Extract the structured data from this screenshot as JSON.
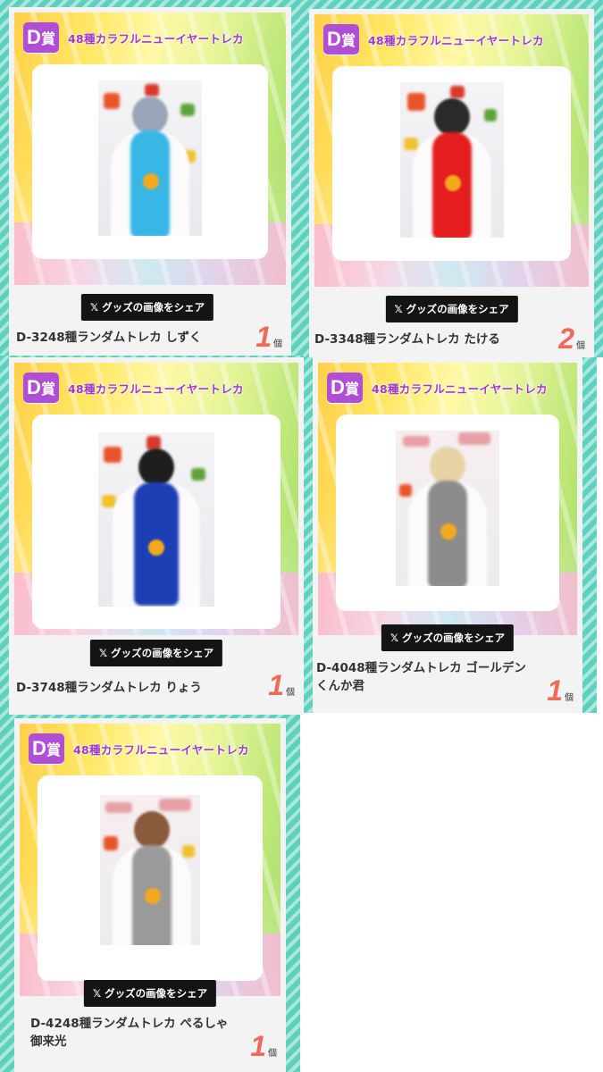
{
  "cards": [
    {
      "prize_letter": "D",
      "prize_suffix": "賞",
      "prize_title": "48種カラフルニューイヤートレカ",
      "share_label": "グッズの画像をシェア",
      "share_icon": "x-logo-icon",
      "item_name": "D-3248種ランダムトレカ しずく",
      "quantity": "1",
      "unit": "個",
      "hair": "#9aa4b8",
      "scarf": "#38b6e6"
    },
    {
      "prize_letter": "D",
      "prize_suffix": "賞",
      "prize_title": "48種カラフルニューイヤートレカ",
      "share_label": "グッズの画像をシェア",
      "share_icon": "x-logo-icon",
      "item_name": "D-3348種ランダムトレカ たける",
      "quantity": "2",
      "unit": "個",
      "hair": "#2a2a2a",
      "scarf": "#e41e1e"
    },
    {
      "prize_letter": "D",
      "prize_suffix": "賞",
      "prize_title": "48種カラフルニューイヤートレカ",
      "share_label": "グッズの画像をシェア",
      "share_icon": "x-logo-icon",
      "item_name": "D-3748種ランダムトレカ りょう",
      "quantity": "1",
      "unit": "個",
      "hair": "#1e1e1e",
      "scarf": "#1d3fb5"
    },
    {
      "prize_letter": "D",
      "prize_suffix": "賞",
      "prize_title": "48種カラフルニューイヤートレカ",
      "share_label": "グッズの画像をシェア",
      "share_icon": "x-logo-icon",
      "item_name": "D-4048種ランダムトレカ ゴールデンくんか君",
      "quantity": "1",
      "unit": "個",
      "hair": "#e8d3a6",
      "scarf": "#8c8c8c"
    },
    {
      "prize_letter": "D",
      "prize_suffix": "賞",
      "prize_title": "48種カラフルニューイヤートレカ",
      "share_label": "グッズの画像をシェア",
      "share_icon": "x-logo-icon",
      "item_name": "D-4248種ランダムトレカ ぺるしゃ御来光",
      "quantity": "1",
      "unit": "個",
      "hair": "#8a5a3c",
      "scarf": "#9a9a9a"
    }
  ]
}
